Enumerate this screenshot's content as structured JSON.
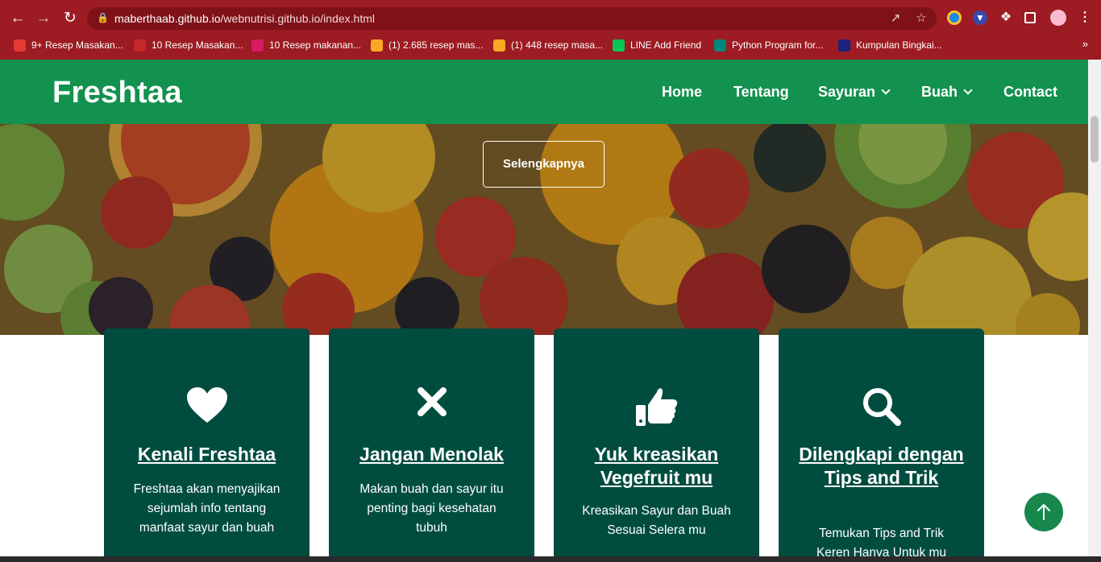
{
  "browser": {
    "url_host": "maberthaab.github.io",
    "url_path": "/webnutrisi.github.io/index.html",
    "bookmarks": [
      {
        "label": "9+ Resep Masakan...",
        "color": "#e53935"
      },
      {
        "label": "10 Resep Masakan...",
        "color": "#c62828"
      },
      {
        "label": "10 Resep makanan...",
        "color": "#d81b60"
      },
      {
        "label": "(1) 2.685 resep mas...",
        "color": "#f9a825"
      },
      {
        "label": "(1) 448 resep masa...",
        "color": "#f9a825"
      },
      {
        "label": "LINE Add Friend",
        "color": "#06c755"
      },
      {
        "label": "Python Program for...",
        "color": "#00897b"
      },
      {
        "label": "Kumpulan Bingkai...",
        "color": "#1a237e"
      }
    ],
    "bookmarks_more": "»"
  },
  "site": {
    "brand": "Freshtaa",
    "nav": [
      {
        "label": "Home",
        "dropdown": false
      },
      {
        "label": "Tentang",
        "dropdown": false
      },
      {
        "label": "Sayuran",
        "dropdown": true
      },
      {
        "label": "Buah",
        "dropdown": true
      },
      {
        "label": "Contact",
        "dropdown": false
      }
    ],
    "hero_button": "Selengkapnya",
    "cards": [
      {
        "icon": "heart-icon",
        "title": "Kenali Freshtaa",
        "text": "Freshtaa akan menyajikan sejumlah info tentang manfaat sayur dan buah"
      },
      {
        "icon": "x-mark-icon",
        "title": "Jangan Menolak",
        "text": "Makan buah dan sayur itu penting bagi kesehatan tubuh"
      },
      {
        "icon": "thumbs-up-icon",
        "title": "Yuk kreasikan Vegefruit mu",
        "text": "Kreasikan Sayur dan Buah Sesuai Selera mu"
      },
      {
        "icon": "magnifier-icon",
        "title": "Dilengkapi dengan Tips and Trik",
        "text": "Temukan Tips and Trik Keren Hanya Untuk mu"
      }
    ]
  },
  "colors": {
    "chrome": "#9d1b22",
    "navbar": "#13914f",
    "card": "#004d40",
    "back_to_top": "#17874b"
  }
}
